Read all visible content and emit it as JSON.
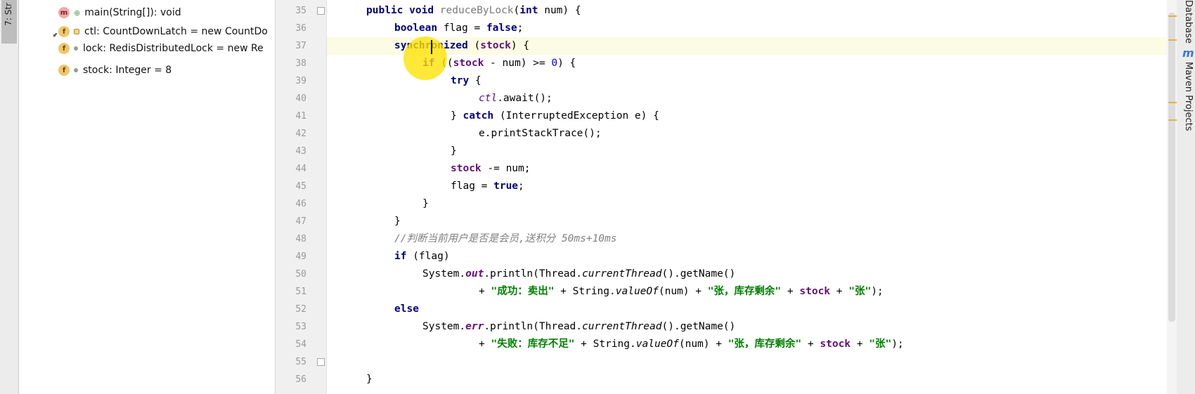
{
  "left_panel": {
    "tab_label": "7: Str"
  },
  "structure": {
    "items": [
      {
        "kind": "m",
        "text": "main(String[]): void"
      },
      {
        "kind": "f",
        "text": "ctl: CountDownLatch = new CountDo"
      },
      {
        "kind": "f",
        "text": "lock: RedisDistributedLock = new Re"
      },
      {
        "kind": "f",
        "text": "stock: Integer = 8"
      }
    ]
  },
  "editor": {
    "line_numbers": [
      "35",
      "36",
      "37",
      "38",
      "39",
      "40",
      "41",
      "42",
      "43",
      "44",
      "45",
      "46",
      "47",
      "48",
      "49",
      "50",
      "51",
      "52",
      "53",
      "54",
      "55",
      "56"
    ],
    "current_line": "37",
    "code": {
      "l35": {
        "kw1": "public",
        "kw2": "void",
        "method": "reduceByLock",
        "open": "(",
        "kw3": "int",
        "rest": " num) {"
      },
      "l36": {
        "kw1": "boolean",
        "mid": " flag = ",
        "kw2": "false",
        "end": ";"
      },
      "l37": {
        "kw1": "synchronized",
        "mid": " (",
        "fld": "stock",
        "end": ") {"
      },
      "l38": {
        "kw1": "if",
        "mid": " ((",
        "fld": "stock",
        "rest": " - num) >= ",
        "num": "0",
        "end": ") {"
      },
      "l39": {
        "kw1": "try",
        "end": " {"
      },
      "l40": {
        "fld": "ctl",
        "end": ".await();"
      },
      "l41": {
        "pre": "} ",
        "kw1": "catch",
        "end": " (InterruptedException e) {"
      },
      "l42": {
        "text": "e.printStackTrace();"
      },
      "l43": {
        "text": "}"
      },
      "l44": {
        "fld": "stock",
        "end": " -= num;"
      },
      "l45": {
        "mid": "flag = ",
        "kw1": "true",
        "end": ";"
      },
      "l46": {
        "text": "}"
      },
      "l47": {
        "text": "}"
      },
      "l48": {
        "comment": "//判断当前用户是否是会员,送积分 50ms+10ms"
      },
      "l49": {
        "kw1": "if",
        "end": " (flag)"
      },
      "l50": {
        "pre": "System.",
        "st": "out",
        "mid": ".println(Thread.",
        "st2": "currentThread",
        "end": "().getName()"
      },
      "l51": {
        "pre": "+ ",
        "s1": "\"成功：卖出\"",
        "mid": " + String.",
        "st": "valueOf",
        "mid2": "(num) + ",
        "s2": "\"张，库存剩余\"",
        "mid3": " + ",
        "fld": "stock",
        "mid4": " + ",
        "s3": "\"张\"",
        "end": ");"
      },
      "l52": {
        "kw1": "else"
      },
      "l53": {
        "pre": "System.",
        "st": "err",
        "mid": ".println(Thread.",
        "st2": "currentThread",
        "end": "().getName()"
      },
      "l54": {
        "pre": "+ ",
        "s1": "\"失败：库存不足\"",
        "mid": " + String.",
        "st": "valueOf",
        "mid2": "(num) + ",
        "s2": "\"张，库存剩余\"",
        "mid3": " + ",
        "fld": "stock",
        "mid4": " + ",
        "s3": "\"张\"",
        "end": ");"
      },
      "l55": {
        "text": ""
      },
      "l56": {
        "text": "}"
      }
    }
  },
  "right_panel": {
    "database_label": "Database",
    "maven_icon": "m",
    "maven_label": "Maven Projects"
  },
  "colors": {
    "keyword": "#000080",
    "field": "#660e7a",
    "string": "#008000",
    "number": "#0000ff",
    "comment": "#808080",
    "cursor_highlight": "#ffe100",
    "current_line": "#fcfbe3"
  }
}
